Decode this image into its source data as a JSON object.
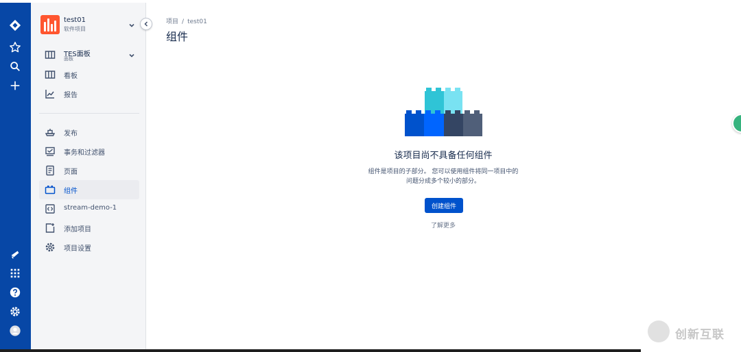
{
  "sidebar": {
    "project": {
      "name": "test01",
      "type": "软件项目"
    },
    "board_selector": {
      "name": "TES面板",
      "sub": "面板"
    },
    "items_top": [
      {
        "label": "看板",
        "icon": "board-icon"
      },
      {
        "label": "报告",
        "icon": "chart-icon"
      }
    ],
    "items_bottom": [
      {
        "label": "发布",
        "icon": "ship-icon"
      },
      {
        "label": "事务和过滤器",
        "icon": "issues-icon"
      },
      {
        "label": "页面",
        "icon": "page-icon"
      },
      {
        "label": "组件",
        "icon": "component-icon",
        "active": true
      },
      {
        "label": "stream-demo-1",
        "icon": "code-icon"
      },
      {
        "label": "添加项目",
        "icon": "add-item-icon"
      },
      {
        "label": "项目设置",
        "icon": "gear-icon"
      }
    ]
  },
  "main": {
    "breadcrumb": {
      "root": "项目",
      "separator": "/",
      "current": "test01"
    },
    "title": "组件",
    "empty_state": {
      "title": "该项目尚不具备任何组件",
      "description": "组件是项目的子部分。 您可以使用组件将同一项目中的问题分成多个较小的部分。",
      "create_label": "创建组件",
      "learn_more": "了解更多"
    }
  },
  "watermark": {
    "text": "创新互联"
  },
  "colors": {
    "global_nav": "#0747a6",
    "sidebar_bg": "#f4f5f7",
    "primary": "#0052cc",
    "project_avatar": "#ff5630"
  }
}
